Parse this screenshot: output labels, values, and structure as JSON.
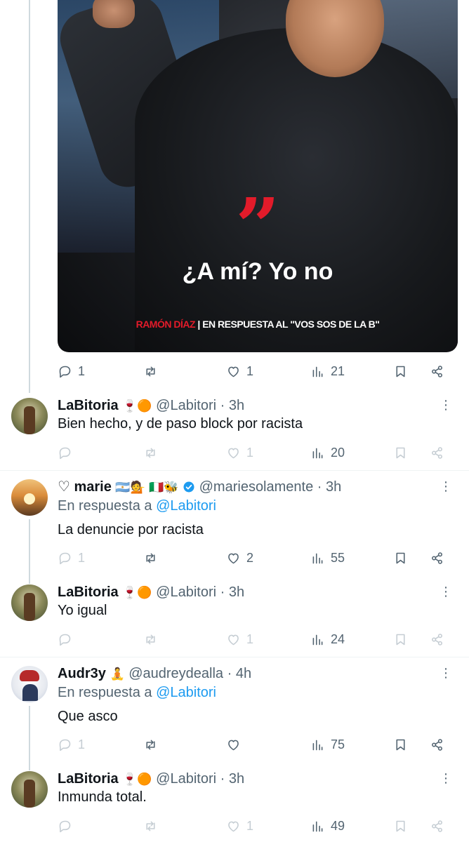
{
  "media": {
    "quote_mark": "”",
    "quote_text": "¿A mí? Yo no",
    "caption_red": "RAMÓN DÍAZ",
    "caption_rest": " | EN RESPUESTA AL \"VOS SOS DE LA B\""
  },
  "main_actions": {
    "replies": "1",
    "retweets": "",
    "likes": "1",
    "views": "21"
  },
  "tweets": [
    {
      "name": "LaBitoria",
      "emoji": "🍷🟠",
      "handle": "@Labitori",
      "time": "3h",
      "text": "Bien hecho, y de paso block por racista",
      "actions": {
        "replies": "",
        "retweets": "",
        "likes": "1",
        "views": "20"
      }
    },
    {
      "name": "♡ marie",
      "emoji": "🇦🇷💁 🇮🇹🐝",
      "handle": "@mariesolamente",
      "time": "3h",
      "reply_prefix": "En respuesta a ",
      "reply_handle": "@Labitori",
      "text": "La denuncie por racista",
      "actions": {
        "replies": "1",
        "retweets": "",
        "likes": "2",
        "views": "55"
      }
    },
    {
      "name": "LaBitoria",
      "emoji": "🍷🟠",
      "handle": "@Labitori",
      "time": "3h",
      "text": "Yo igual",
      "actions": {
        "replies": "",
        "retweets": "",
        "likes": "1",
        "views": "24"
      }
    },
    {
      "name": "Audr3y",
      "emoji": "🧘",
      "handle": "@audreydealla",
      "time": "4h",
      "reply_prefix": "En respuesta a ",
      "reply_handle": "@Labitori",
      "text": "Que asco",
      "actions": {
        "replies": "1",
        "retweets": "",
        "likes": "",
        "views": "75"
      }
    },
    {
      "name": "LaBitoria",
      "emoji": "🍷🟠",
      "handle": "@Labitori",
      "time": "3h",
      "text": "Inmunda total.",
      "actions": {
        "replies": "",
        "retweets": "",
        "likes": "1",
        "views": "49"
      }
    }
  ],
  "separator": " · ",
  "more_label": "⋮",
  "colors": {
    "text": "#0f1419",
    "secondary": "#536471",
    "link": "#1d9bf0",
    "verified": "#1d9bf0",
    "quote_red": "#e21b2a"
  }
}
